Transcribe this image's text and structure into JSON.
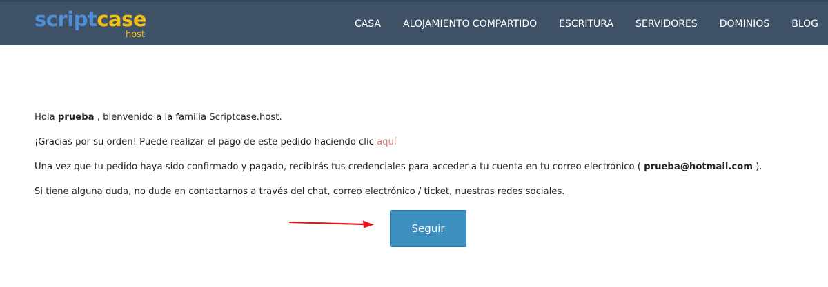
{
  "header": {
    "logo": {
      "part1": "script",
      "part2": "case",
      "sub": "host"
    },
    "nav": [
      {
        "label": "CASA"
      },
      {
        "label": "ALOJAMIENTO COMPARTIDO"
      },
      {
        "label": "ESCRITURA"
      },
      {
        "label": "SERVIDORES"
      },
      {
        "label": "DOMINIOS"
      },
      {
        "label": "BLOG"
      }
    ]
  },
  "message": {
    "line1": {
      "before": "Hola ",
      "username": "prueba",
      "after": " , bienvenido a la familia Scriptcase.host."
    },
    "line2": {
      "text": "¡Gracias por su orden! Puede realizar el pago de este pedido haciendo clic ",
      "link": "aquí"
    },
    "line3": {
      "before": "Una vez que tu pedido haya sido confirmado y pagado, recibirás tus credenciales para acceder a tu cuenta en tu correo electrónico ( ",
      "email": "prueba@hotmail.com",
      "after": " )."
    },
    "line4": "Si tiene alguna duda, no dude en contactarnos a través del chat, correo electrónico / ticket, nuestras redes sociales."
  },
  "continue_button": {
    "label": "Seguir"
  },
  "annotation": {
    "arrow_icon": "red-arrow-right-icon",
    "color": "#e8141c"
  },
  "colors": {
    "header_bg": "#3f5166",
    "logo_blue": "#4f8fd6",
    "logo_yellow": "#f3c019",
    "button_bg": "#3d8fbe",
    "link": "#e07b7b"
  }
}
